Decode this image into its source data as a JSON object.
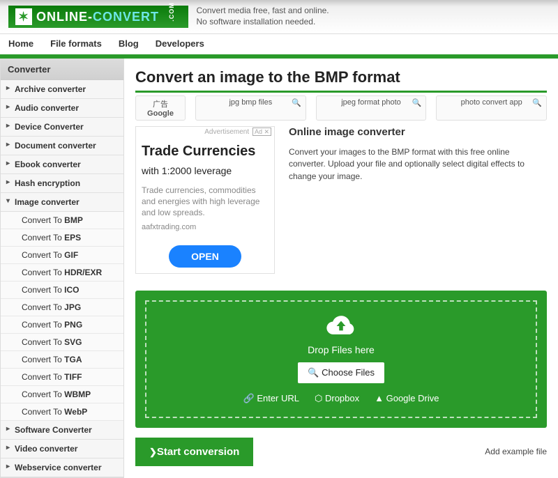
{
  "header": {
    "logo_text_main": "ONLINE-",
    "logo_text_accent": "CONVERT",
    "logo_com": ".COM",
    "tagline1": "Convert media free, fast and online.",
    "tagline2": "No software installation needed."
  },
  "nav": [
    "Home",
    "File formats",
    "Blog",
    "Developers"
  ],
  "sidebar": {
    "title": "Converter",
    "items": [
      {
        "label": "Archive converter",
        "expanded": false
      },
      {
        "label": "Audio converter",
        "expanded": false
      },
      {
        "label": "Device Converter",
        "expanded": false
      },
      {
        "label": "Document converter",
        "expanded": false
      },
      {
        "label": "Ebook converter",
        "expanded": false
      },
      {
        "label": "Hash encryption",
        "expanded": false
      },
      {
        "label": "Image converter",
        "expanded": true,
        "subs": [
          {
            "prefix": "Convert To ",
            "fmt": "BMP"
          },
          {
            "prefix": "Convert To ",
            "fmt": "EPS"
          },
          {
            "prefix": "Convert To ",
            "fmt": "GIF"
          },
          {
            "prefix": "Convert To ",
            "fmt": "HDR/EXR"
          },
          {
            "prefix": "Convert To ",
            "fmt": "ICO"
          },
          {
            "prefix": "Convert To ",
            "fmt": "JPG"
          },
          {
            "prefix": "Convert To ",
            "fmt": "PNG"
          },
          {
            "prefix": "Convert To ",
            "fmt": "SVG"
          },
          {
            "prefix": "Convert To ",
            "fmt": "TGA"
          },
          {
            "prefix": "Convert To ",
            "fmt": "TIFF"
          },
          {
            "prefix": "Convert To ",
            "fmt": "WBMP"
          },
          {
            "prefix": "Convert To ",
            "fmt": "WebP"
          }
        ]
      },
      {
        "label": "Software Converter",
        "expanded": false
      },
      {
        "label": "Video converter",
        "expanded": false
      },
      {
        "label": "Webservice converter",
        "expanded": false
      }
    ]
  },
  "page": {
    "title": "Convert an image to the BMP format",
    "adrow": {
      "g": "Google",
      "p1": "jpg bmp files",
      "p2": "jpeg format photo",
      "p3": "photo convert app"
    },
    "ad": {
      "label": "Advertisement",
      "tag": "Ad ✕",
      "title": "Trade Currencies",
      "sub": "with 1:2000 leverage",
      "body": "Trade currencies, commodities and energies with high leverage and low spreads.",
      "url": "aafxtrading.com",
      "cta": "OPEN"
    },
    "desc": {
      "heading": "Online image converter",
      "body": "Convert your images to the BMP format with this free online converter. Upload your file and optionally select digital effects to change your image."
    },
    "drop": {
      "label": "Drop Files here",
      "choose": "Choose Files",
      "url": "Enter URL",
      "dropbox": "Dropbox",
      "gdrive": "Google Drive"
    },
    "start": "Start conversion",
    "example": "Add example file"
  }
}
